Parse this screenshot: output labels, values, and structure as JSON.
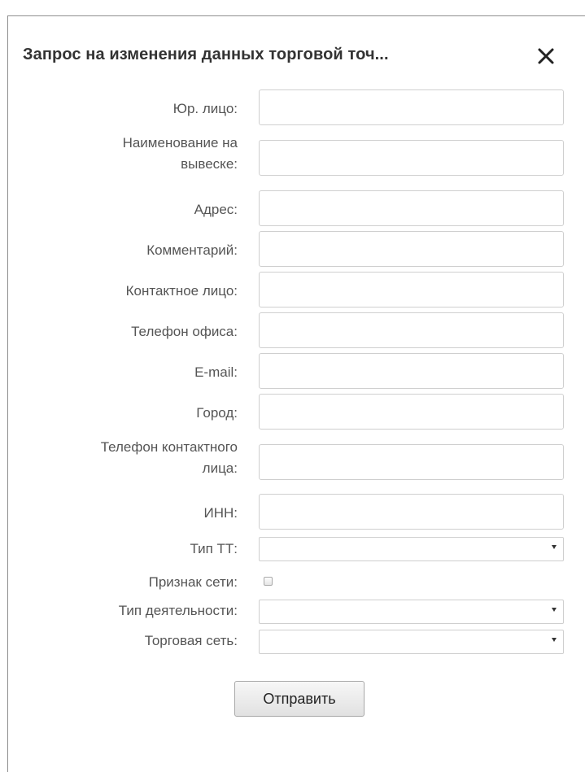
{
  "dialog": {
    "title": "Запрос на изменения данных торговой точ...",
    "close_icon": "close-icon"
  },
  "fields": {
    "legal_entity": {
      "label": "Юр. лицо:",
      "value": ""
    },
    "sign_name": {
      "label_line1": "Наименование на",
      "label_line2": "вывеске:",
      "value": ""
    },
    "address": {
      "label": "Адрес:",
      "value": ""
    },
    "comment": {
      "label": "Комментарий:",
      "value": ""
    },
    "contact_person": {
      "label": "Контактное лицо:",
      "value": ""
    },
    "office_phone": {
      "label": "Телефон офиса:",
      "value": ""
    },
    "email": {
      "label": "E-mail:",
      "value": ""
    },
    "city": {
      "label": "Город:",
      "value": ""
    },
    "contact_phone": {
      "label_line1": "Телефон контактного",
      "label_line2": "лица:",
      "value": ""
    },
    "inn": {
      "label": "ИНН:",
      "value": ""
    },
    "outlet_type": {
      "label": "Тип ТТ:",
      "selected": ""
    },
    "chain_flag": {
      "label": "Признак сети:",
      "checked": false
    },
    "activity_type": {
      "label": "Тип деятельности:",
      "selected": ""
    },
    "retail_chain": {
      "label": "Торговая сеть:",
      "selected": ""
    }
  },
  "actions": {
    "submit_label": "Отправить"
  }
}
